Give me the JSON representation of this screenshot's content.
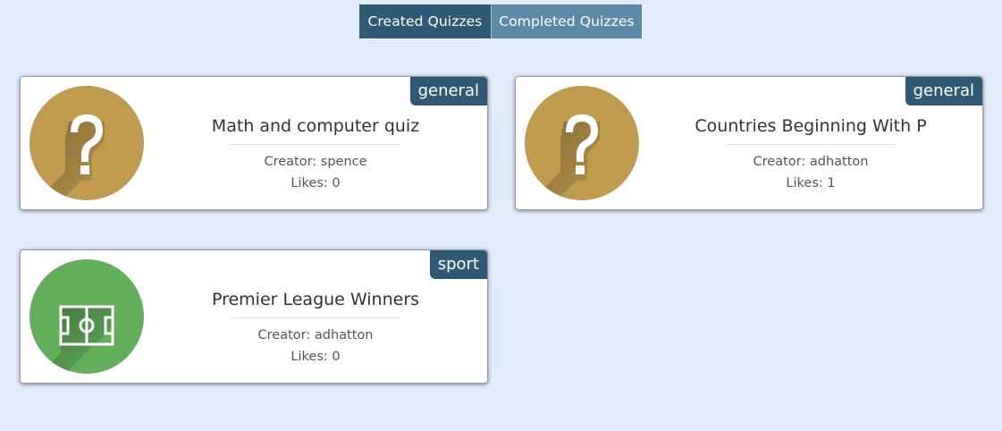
{
  "tabs": {
    "created_label": "Created Quizzes",
    "completed_label": "Completed Quizzes"
  },
  "quizzes": [
    {
      "title": "Math and computer quiz",
      "category": "general",
      "creator": "Creator: spence",
      "likes": "Likes: 0",
      "icon": "question-mark-icon",
      "icon_color": "#bf9a4f"
    },
    {
      "title": "Countries Beginning With P",
      "category": "general",
      "creator": "Creator: adhatton",
      "likes": "Likes: 1",
      "icon": "question-mark-icon",
      "icon_color": "#bf9a4f"
    },
    {
      "title": "Premier League Winners",
      "category": "sport",
      "creator": "Creator: adhatton",
      "likes": "Likes: 0",
      "icon": "football-pitch-icon",
      "icon_color": "#62ae5b"
    }
  ],
  "colors": {
    "page_background": "#e0ebfc",
    "primary": "#2f5a75",
    "secondary": "#5a8aa6"
  }
}
